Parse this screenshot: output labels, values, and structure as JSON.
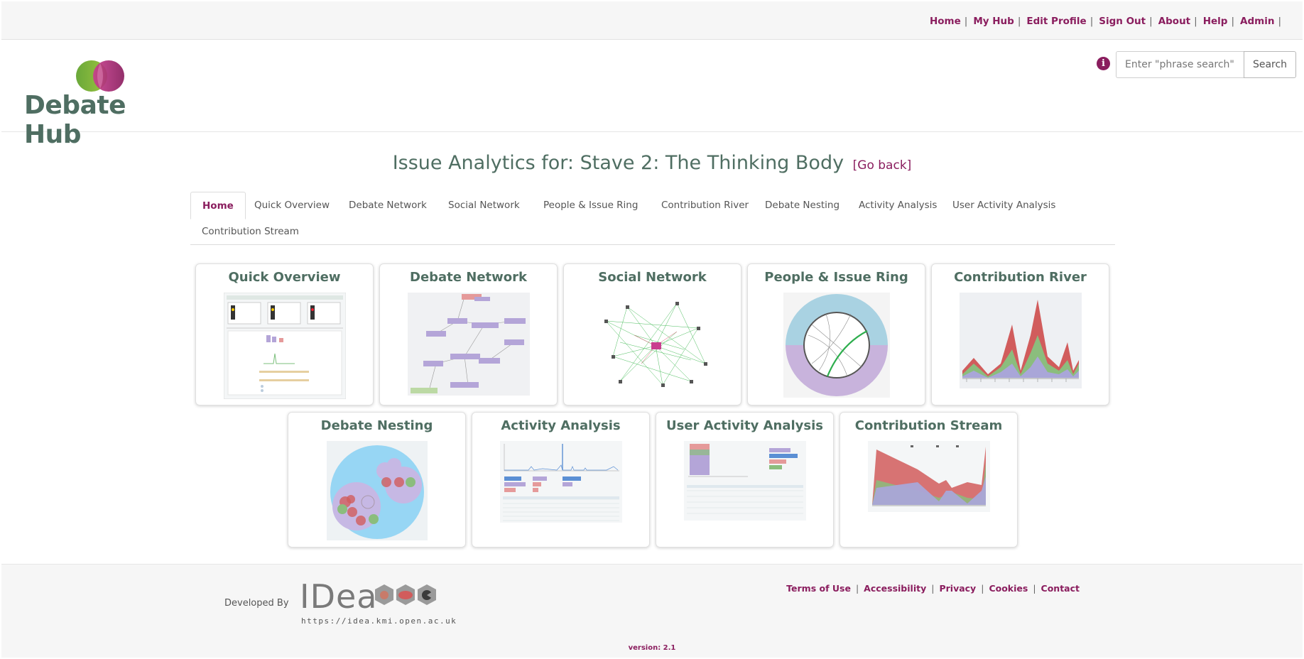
{
  "topnav": {
    "items": [
      {
        "label": "Home"
      },
      {
        "label": "My Hub"
      },
      {
        "label": "Edit Profile"
      },
      {
        "label": "Sign Out"
      },
      {
        "label": "About"
      },
      {
        "label": "Help"
      },
      {
        "label": "Admin"
      }
    ],
    "separator": "|"
  },
  "header": {
    "logo_text": "Debate Hub",
    "info_icon": "info-icon",
    "search_placeholder": "Enter \"phrase search\"",
    "search_button": "Search"
  },
  "page": {
    "title": "Issue Analytics for: Stave 2: The Thinking Body",
    "go_back": "[Go back]"
  },
  "tabs": [
    {
      "label": "Home",
      "active": true
    },
    {
      "label": "Quick Overview"
    },
    {
      "label": "Debate Network"
    },
    {
      "label": "Social Network"
    },
    {
      "label": "People & Issue Ring"
    },
    {
      "label": "Contribution River"
    },
    {
      "label": "Debate Nesting"
    },
    {
      "label": "Activity Analysis"
    },
    {
      "label": "User Activity Analysis"
    },
    {
      "label": "Contribution Stream"
    }
  ],
  "cards": [
    {
      "title": "Quick Overview"
    },
    {
      "title": "Debate Network"
    },
    {
      "title": "Social Network"
    },
    {
      "title": "People & Issue Ring"
    },
    {
      "title": "Contribution River"
    },
    {
      "title": "Debate Nesting"
    },
    {
      "title": "Activity Analysis"
    },
    {
      "title": "User Activity Analysis"
    },
    {
      "title": "Contribution Stream"
    }
  ],
  "footer": {
    "developed_by": "Developed By",
    "idea_logo_text": "IDea",
    "idea_url": "https://idea.kmi.open.ac.uk",
    "links": [
      {
        "label": "Terms of Use"
      },
      {
        "label": "Accessibility"
      },
      {
        "label": "Privacy"
      },
      {
        "label": "Cookies"
      },
      {
        "label": "Contact"
      }
    ],
    "version": "version: 2.1"
  },
  "colors": {
    "accent": "#8a1d5e",
    "brand_green": "#4f6e62"
  }
}
